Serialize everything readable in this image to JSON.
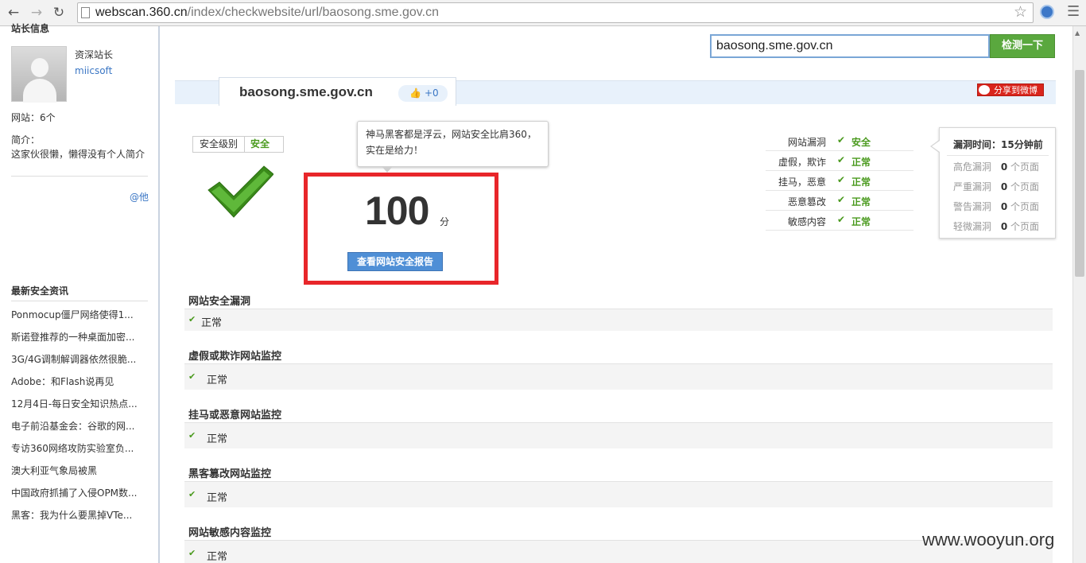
{
  "browser": {
    "url_host": "webscan.360.cn",
    "url_path": "/index/checkwebsite/url/baosong.sme.gov.cn"
  },
  "sidebar": {
    "section_title": "站长信息",
    "role": "资深站长",
    "username": "miicsoft",
    "site_count": "网站：6个",
    "intro_label": "简介：",
    "intro_text": "这家伙很懒，懒得没有个人简介",
    "at_him": "@他",
    "news_title": "最新安全资讯",
    "news": [
      "Ponmocup僵尸网络使得1...",
      "斯诺登推荐的一种桌面加密...",
      "3G/4G调制解调器依然很脆...",
      "Adobe：和Flash说再见",
      "12月4日-每日安全知识热点...",
      "电子前沿基金会：谷歌的网...",
      "专访360网络攻防实验室负...",
      "澳大利亚气象局被黑",
      "中国政府抓捕了入侵OPM数...",
      "黑客：我为什么要黑掉VTe..."
    ]
  },
  "search": {
    "value": "baosong.sme.gov.cn",
    "button": "检测一下"
  },
  "site_tab": {
    "domain": "baosong.sme.gov.cn",
    "like": "+0",
    "share": "分享到微博"
  },
  "score": {
    "level_label": "安全级别",
    "level_value": "安全",
    "tooltip": "神马黑客都是浮云，网站安全比肩360，实在是给力！",
    "value": "100",
    "unit": "分",
    "report_button": "查看网站安全报告"
  },
  "status_list": [
    {
      "label": "网站漏洞",
      "value": "安全"
    },
    {
      "label": "虚假，欺诈",
      "value": "正常"
    },
    {
      "label": "挂马，恶意",
      "value": "正常"
    },
    {
      "label": "恶意篡改",
      "value": "正常"
    },
    {
      "label": "敏感内容",
      "value": "正常"
    }
  ],
  "vuln_panel": {
    "title": "漏洞时间：15分钟前",
    "rows": [
      {
        "label": "高危漏洞",
        "count": "0",
        "unit": "个页面"
      },
      {
        "label": "严重漏洞",
        "count": "0",
        "unit": "个页面"
      },
      {
        "label": "警告漏洞",
        "count": "0",
        "unit": "个页面"
      },
      {
        "label": "轻微漏洞",
        "count": "0",
        "unit": "个页面"
      }
    ]
  },
  "sections": [
    {
      "title": "网站安全漏洞",
      "status": "正常"
    },
    {
      "title": "虚假或欺诈网站监控",
      "status": "正常"
    },
    {
      "title": "挂马或恶意网站监控",
      "status": "正常"
    },
    {
      "title": "黑客篡改网站监控",
      "status": "正常"
    },
    {
      "title": "网站敏感内容监控",
      "status": "正常"
    }
  ],
  "watermark": "www.wooyun.org",
  "icons": [
    "back-arrow-icon",
    "forward-arrow-icon",
    "reload-icon",
    "page-icon",
    "star-icon",
    "globe-icon",
    "thumbs-up-icon",
    "check-icon",
    "weibo-icon",
    "avatar-icon"
  ],
  "colors": {
    "accent_green": "#4a9a1e",
    "search_button": "#5aa83e",
    "report_button": "#4f8fd6",
    "highlight_border": "#e8262a",
    "link_blue": "#3a76c4"
  }
}
